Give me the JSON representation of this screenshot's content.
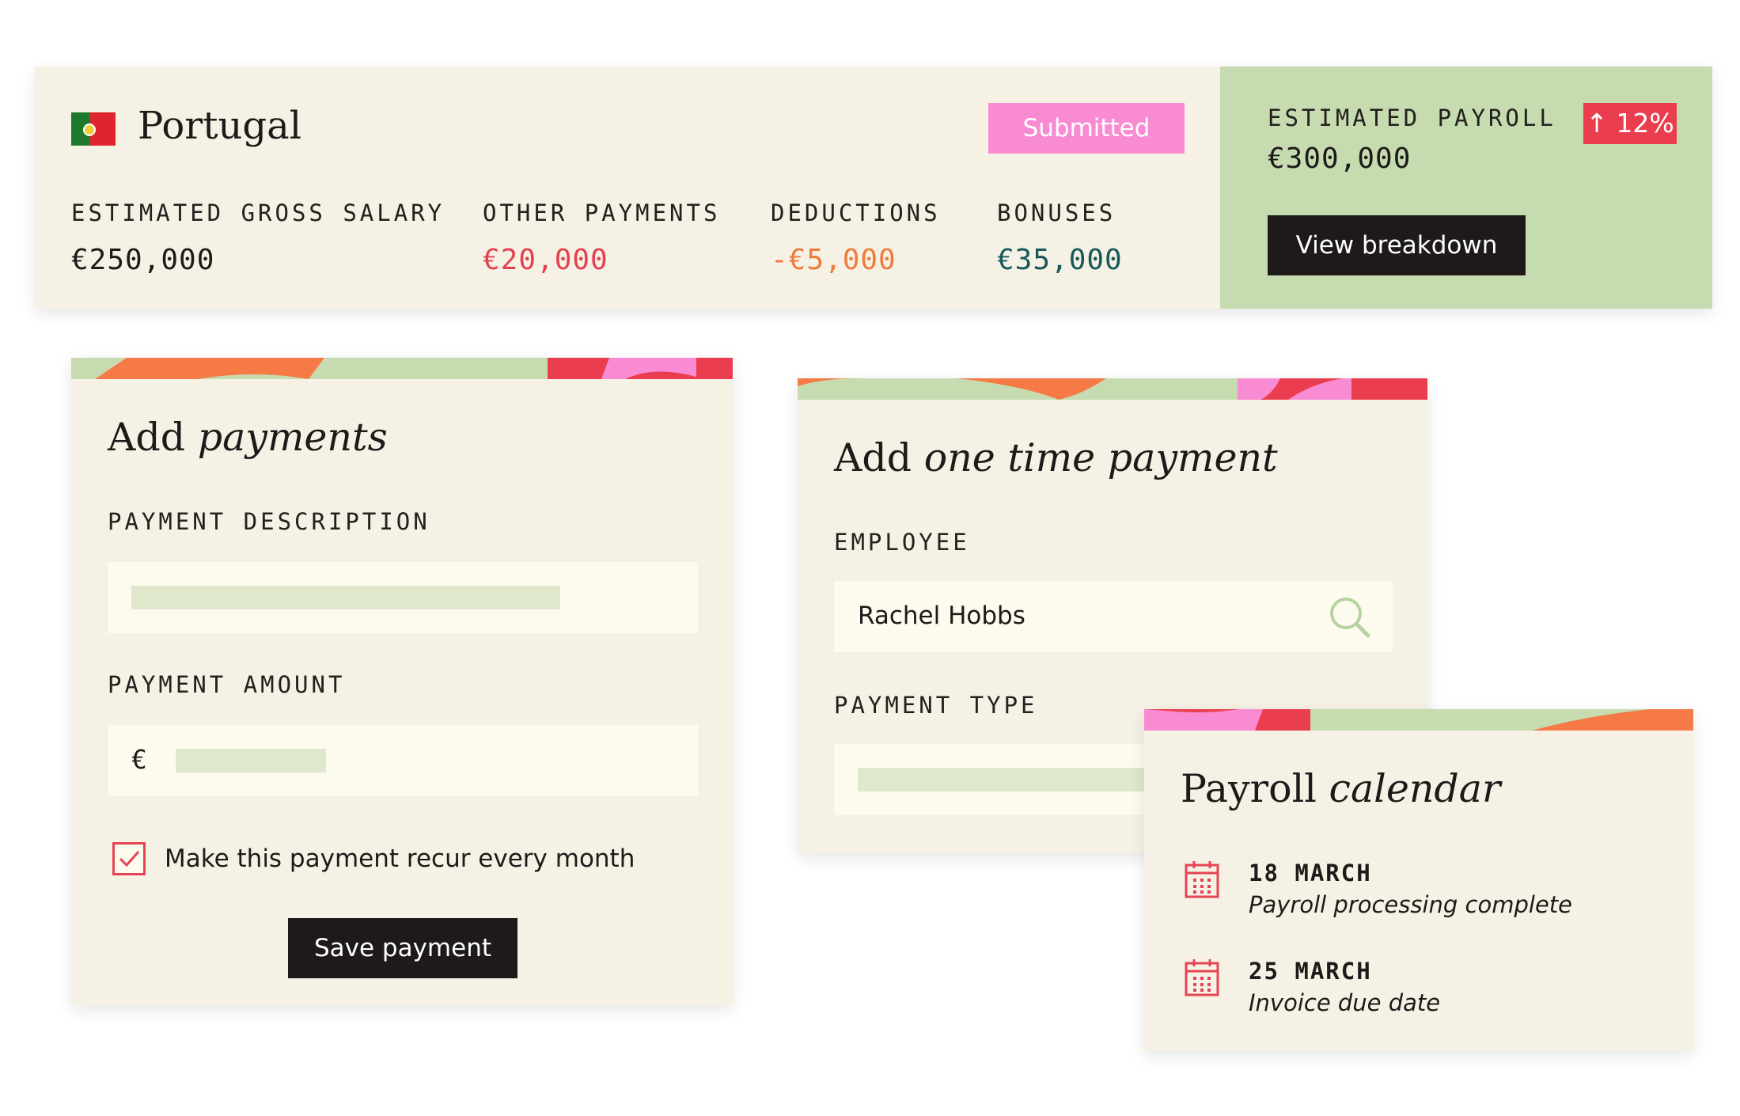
{
  "summary": {
    "country": "Portugal",
    "status_badge": "Submitted",
    "metrics": [
      {
        "label": "ESTIMATED GROSS SALARY",
        "value": "€250,000",
        "color": "#1d1a19"
      },
      {
        "label": "OTHER PAYMENTS",
        "value": "€20,000",
        "color": "#e5404f"
      },
      {
        "label": "DEDUCTIONS",
        "value": "-€5,000",
        "color": "#f07a3c"
      },
      {
        "label": "BONUSES",
        "value": "€35,000",
        "color": "#16585a"
      }
    ],
    "estimated_payroll": {
      "label": "ESTIMATED PAYROLL",
      "value": "€300,000",
      "change": "↑ 12%",
      "button": "View breakdown"
    }
  },
  "add_payments": {
    "title_plain": "Add ",
    "title_italic": "payments",
    "description_label": "PAYMENT DESCRIPTION",
    "amount_label": "PAYMENT AMOUNT",
    "currency_symbol": "€",
    "recur_label": "Make this payment recur every month",
    "recur_checked": true,
    "save_button": "Save payment"
  },
  "one_time_payment": {
    "title_plain": "Add ",
    "title_italic": "one time payment",
    "employee_label": "EMPLOYEE",
    "employee_value": "Rachel Hobbs",
    "payment_type_label": "PAYMENT TYPE"
  },
  "payroll_calendar": {
    "title_plain": "Payroll ",
    "title_italic": "calendar",
    "items": [
      {
        "date": "18 MARCH",
        "description": "Payroll processing complete"
      },
      {
        "date": "25 MARCH",
        "description": "Invoice due date"
      }
    ]
  },
  "colors": {
    "card_bg": "#f5f2e5",
    "input_bg": "#fdfbed",
    "green_panel": "#c6dbb0",
    "pink": "#f98bd3",
    "red": "#ea3e4f",
    "orange": "#f07a3c"
  }
}
